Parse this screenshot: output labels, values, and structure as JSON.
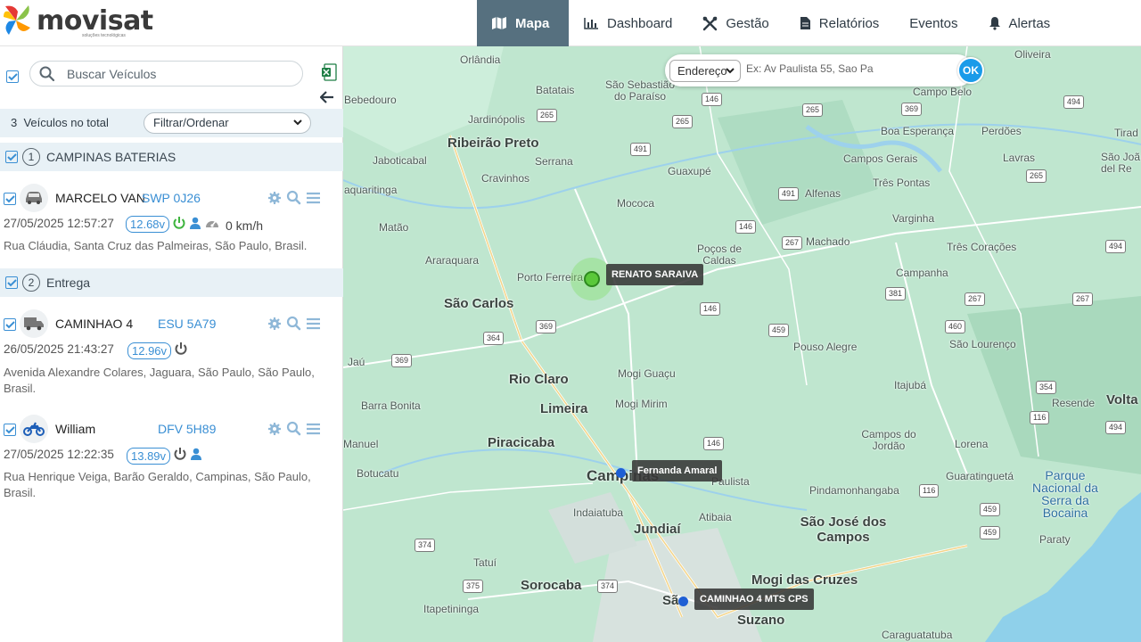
{
  "brand": {
    "name": "movisat",
    "tagline": "soluções tecnológicas"
  },
  "nav": {
    "items": [
      {
        "label": "Mapa",
        "icon": "map-icon",
        "active": true
      },
      {
        "label": "Dashboard",
        "icon": "bar-chart-icon"
      },
      {
        "label": "Gestão",
        "icon": "tools-icon"
      },
      {
        "label": "Relatórios",
        "icon": "document-icon"
      },
      {
        "label": "Eventos",
        "icon": ""
      },
      {
        "label": "Alertas",
        "icon": "bell-icon"
      }
    ]
  },
  "sidebar": {
    "search_placeholder": "Buscar Veículos",
    "total_count": "3",
    "total_label": "Veículos no total",
    "filter_label": "Filtrar/Ordenar",
    "groups": [
      {
        "number": "1",
        "name": "CAMPINAS BATERIAS",
        "vehicles": [
          {
            "name": "MARCELO VAN",
            "plate": "SWP 0J26",
            "type": "car",
            "datetime": "27/05/2025 12:57:27",
            "voltage": "12.68v",
            "speed": "0 km/h",
            "address": "Rua Cláudia, Santa Cruz das Palmeiras, São Paulo, Brasil."
          }
        ]
      },
      {
        "number": "2",
        "name": "Entrega",
        "vehicles": [
          {
            "name": "CAMINHAO 4",
            "plate": "ESU 5A79",
            "type": "truck",
            "datetime": "26/05/2025 21:43:27",
            "voltage": "12.96v",
            "speed": "",
            "address": "Avenida Alexandre Colares, Jaguara, São Paulo, São Paulo, Brasil."
          },
          {
            "name": "William",
            "plate": "DFV 5H89",
            "type": "motorcycle",
            "datetime": "27/05/2025 12:22:35",
            "voltage": "13.89v",
            "speed": "",
            "address": "Rua Henrique Veiga, Barão Geraldo, Campinas, São Paulo, Brasil."
          }
        ]
      }
    ]
  },
  "map": {
    "address_type": "Endereço",
    "address_placeholder": "Ex: Av Paulista 55, Sao Pa",
    "ok_label": "OK",
    "markers": [
      {
        "label": "RENATO SARAIVA",
        "status": "online"
      },
      {
        "label": "Fernanda Amaral",
        "status": "offline"
      },
      {
        "label": "CAMINHAO 4 MTS CPS",
        "status": "offline"
      }
    ],
    "cities": {
      "orlandia": "Orlândia",
      "batatais": "Batatais",
      "sao_sebastiao": "São Sebastião do Paraíso",
      "bebedouro": "Bebedouro",
      "jardinopolis": "Jardinópolis",
      "ribeirao_preto": "Ribeirão Preto",
      "jaboticabal": "Jaboticabal",
      "serrana": "Serrana",
      "cravinhos": "Cravinhos",
      "aquaritinga": "aquaritinga",
      "guaxupe": "Guaxupé",
      "mococa": "Mococa",
      "alfenas": "Alfenas",
      "matao": "Matão",
      "araraquara": "Araraquara",
      "porto_ferreira": "Porto Ferreira",
      "pocos_caldas": "Poços de Caldas",
      "machado": "Machado",
      "sao_carlos": "São Carlos",
      "rio_claro": "Rio Claro",
      "mogi_guacu": "Mogi Guaçu",
      "limeira": "Limeira",
      "mogi_mirim": "Mogi Mirim",
      "barra_bonita": "Barra Bonita",
      "jau": "Jaú",
      "piracicaba": "Piracicaba",
      "campinas": "Campinas",
      "manuel": "Manuel",
      "botucatu": "Botucatu",
      "indaiatuba": "Indaiatuba",
      "atibaia": "Atibaia",
      "jundiai": "Jundiaí",
      "tatui": "Tatuí",
      "sorocaba": "Sorocaba",
      "itapetininga": "Itapetininga",
      "sao_paulo": "São",
      "suzano": "Suzano",
      "mogi_cruzes": "Mogi das Cruzes",
      "sao_jose": "São José dos Campos",
      "oliveira": "Oliveira",
      "campo_belo": "Campo Belo",
      "boa_esperanca": "Boa Esperança",
      "perdoes": "Perdões",
      "lavras": "Lavras",
      "campos_gerais": "Campos Gerais",
      "tres_pontas": "Três Pontas",
      "varginha": "Varginha",
      "tres_coracoes": "Três Corações",
      "campanha": "Campanha",
      "pouso_alegre": "Pouso Alegre",
      "sao_lourenco": "São Lourenço",
      "itajuba": "Itajubá",
      "resende": "Resende",
      "volta": "Volta",
      "campos_jordao": "Campos do Jordão",
      "lorena": "Lorena",
      "guaratingueta": "Guaratinguetá",
      "pindamonhangaba": "Pindamonhangaba",
      "parque": "Parque Nacional da Serra da Bocaina",
      "paraty": "Paraty",
      "caraguatatuba": "Caraguatatuba",
      "tirad": "Tirad",
      "sao_joao": "São Joã del Re",
      "paulista": "Paulista"
    }
  }
}
